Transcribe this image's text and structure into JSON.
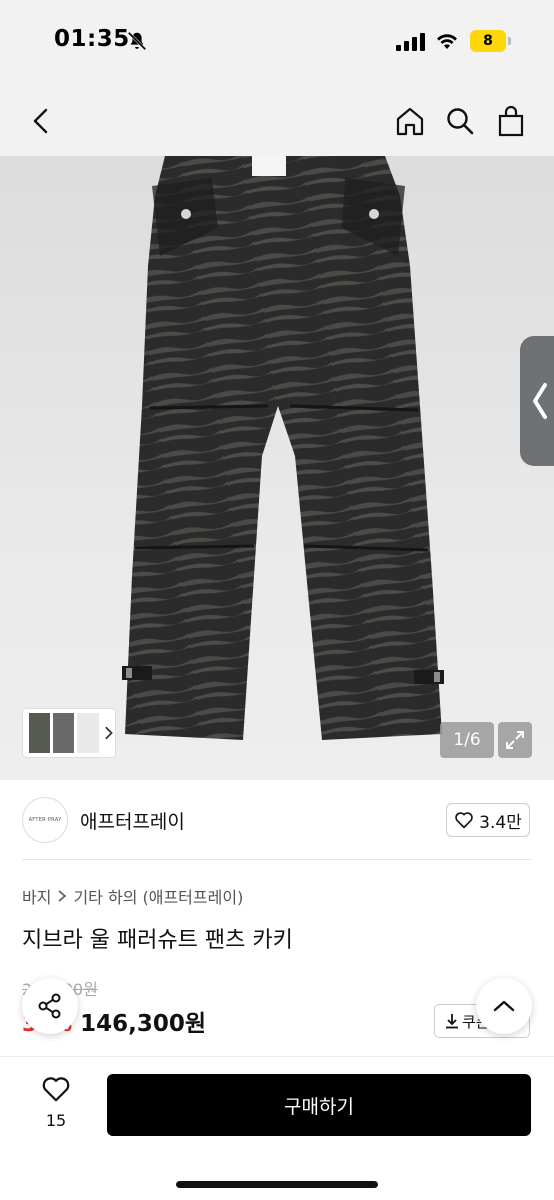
{
  "status_bar": {
    "time": "01:35",
    "battery": "8"
  },
  "product_image": {
    "counter": "1/6"
  },
  "brand": {
    "logo_text": "AFTER PRAY",
    "name": "애프터프레이",
    "likes": "3.4만"
  },
  "breadcrumb": {
    "category": "바지",
    "subcategory": "기타 하의 (애프터프레이)"
  },
  "product": {
    "title": "지브라 울 패러슈트 팬츠 카키",
    "original_price": "2??,?00원",
    "discount": "3?%",
    "sale_price": "146,300원",
    "coupon_label": "쿠폰"
  },
  "bottom_bar": {
    "wish_count": "15",
    "buy_label": "구매하기"
  }
}
